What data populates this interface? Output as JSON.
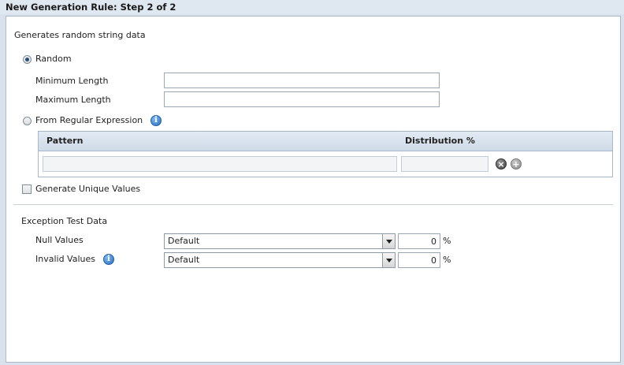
{
  "title": "New Generation Rule: Step 2 of 2",
  "description": "Generates random string data",
  "random": {
    "label": "Random",
    "selected": true,
    "min_length_label": "Minimum Length",
    "min_length_value": "",
    "max_length_label": "Maximum Length",
    "max_length_value": ""
  },
  "regex": {
    "label": "From Regular Expression",
    "selected": false,
    "grid": {
      "columns": [
        "Pattern",
        "Distribution %"
      ],
      "row": {
        "pattern": "",
        "distribution": ""
      }
    }
  },
  "unique": {
    "label": "Generate Unique Values",
    "checked": false
  },
  "exception": {
    "heading": "Exception Test Data",
    "null_values": {
      "label": "Null Values",
      "selected": "Default",
      "percent": "0",
      "unit": "%"
    },
    "invalid_values": {
      "label": "Invalid Values",
      "selected": "Default",
      "percent": "0",
      "unit": "%"
    }
  },
  "icons": {
    "info": "info-icon",
    "remove": "remove-row-icon",
    "add": "add-row-icon"
  }
}
